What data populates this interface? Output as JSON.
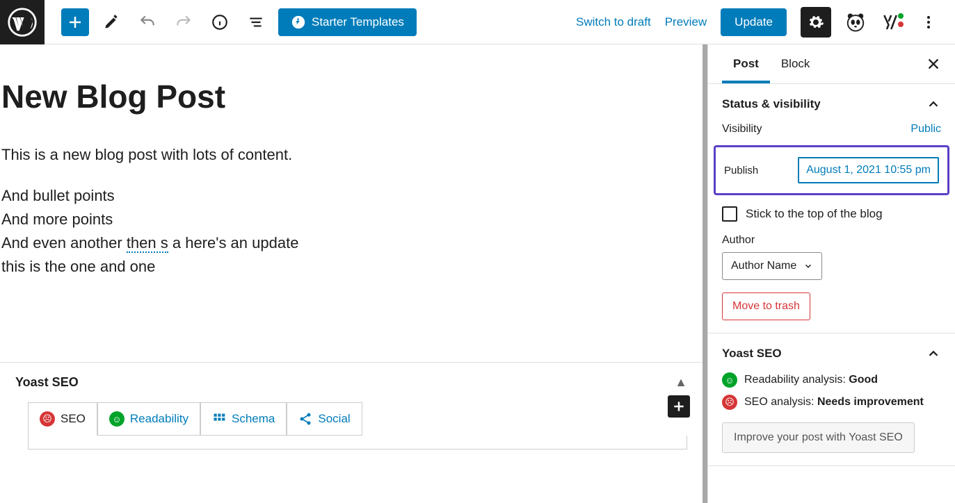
{
  "toolbar": {
    "starter_templates": "Starter Templates",
    "switch_draft": "Switch to draft",
    "preview": "Preview",
    "update": "Update"
  },
  "post": {
    "title": "New Blog Post",
    "para1": "This is a new blog post with lots of content.",
    "line1": "And bullet points",
    "line2": "And more points",
    "line3_a": "And even another ",
    "line3_mis": "then s",
    "line3_b": " a here's an update",
    "line4": "this is the one and one"
  },
  "yoast_bottom": {
    "title": "Yoast SEO",
    "tabs": {
      "seo": "SEO",
      "readability": "Readability",
      "schema": "Schema",
      "social": "Social"
    }
  },
  "sidebar": {
    "tabs": {
      "post": "Post",
      "block": "Block"
    },
    "status": {
      "title": "Status & visibility",
      "visibility_label": "Visibility",
      "visibility_value": "Public",
      "publish_label": "Publish",
      "publish_value": "August 1, 2021 10:55 pm",
      "stick_label": "Stick to the top of the blog",
      "author_label": "Author",
      "author_value": "Author Name",
      "trash": "Move to trash"
    },
    "yoast": {
      "title": "Yoast SEO",
      "readability_prefix": "Readability analysis: ",
      "readability_value": "Good",
      "seo_prefix": "SEO analysis: ",
      "seo_value": "Needs improvement",
      "improve": "Improve your post with Yoast SEO"
    }
  }
}
